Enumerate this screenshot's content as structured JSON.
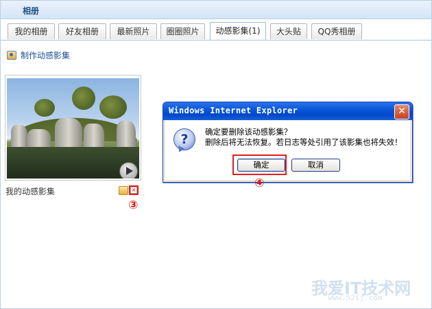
{
  "header": {
    "title": "相册"
  },
  "tabs": [
    {
      "label": "我的相册",
      "active": false
    },
    {
      "label": "好友相册",
      "active": false
    },
    {
      "label": "最新照片",
      "active": false
    },
    {
      "label": "圈圈照片",
      "active": false
    },
    {
      "label": "动感影集(1)",
      "active": true
    },
    {
      "label": "大头贴",
      "active": false
    },
    {
      "label": "QQ秀相册",
      "active": false
    }
  ],
  "create_link": {
    "label": "制作动感影集"
  },
  "album": {
    "name": "我的动感影集"
  },
  "steps": {
    "delete": "③",
    "confirm": "④"
  },
  "dialog": {
    "title": "Windows Internet Explorer",
    "line1": "确定要删除该动感影集？",
    "line2": "删除后将无法恢复。若日志等处引用了该影集也将失效！",
    "ok_label": "确定",
    "cancel_label": "取消",
    "close_label": "✕"
  },
  "watermark": {
    "text": "我爱IT技术网",
    "url": "www.52ij.com"
  },
  "colors": {
    "highlight": "#e21c1c",
    "link": "#1d4d9d",
    "dialog_title": "#0a58da"
  }
}
